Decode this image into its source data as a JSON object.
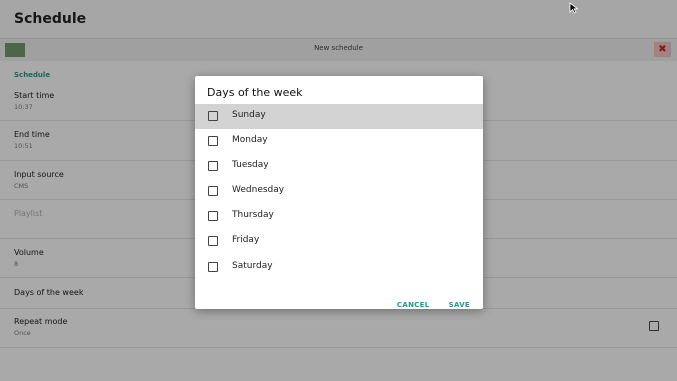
{
  "appbar": {
    "title": "Schedule"
  },
  "subbar": {
    "green_label": "",
    "center_label": "New schedule",
    "close_icon": "✖"
  },
  "form": {
    "section_label": "Schedule",
    "rows": [
      {
        "label": "Start time",
        "value": "10:37"
      },
      {
        "label": "End time",
        "value": "10:51"
      },
      {
        "label": "Input source",
        "value": "CMS"
      },
      {
        "label": "Playlist",
        "value": ""
      },
      {
        "label": "Volume",
        "value": "8"
      },
      {
        "label": "Days of the week",
        "value": ""
      },
      {
        "label": "Repeat mode",
        "value": "Once"
      }
    ]
  },
  "dialog": {
    "title": "Days of the week",
    "options": [
      {
        "label": "Sunday",
        "checked": false,
        "highlighted": true
      },
      {
        "label": "Monday",
        "checked": false
      },
      {
        "label": "Tuesday",
        "checked": false
      },
      {
        "label": "Wednesday",
        "checked": false
      },
      {
        "label": "Thursday",
        "checked": false
      },
      {
        "label": "Friday",
        "checked": false
      },
      {
        "label": "Saturday",
        "checked": false
      }
    ],
    "cancel_label": "CANCEL",
    "save_label": "SAVE"
  },
  "colors": {
    "accent": "#1f9a88",
    "close": "#c62828",
    "green": "#6f9a68"
  }
}
